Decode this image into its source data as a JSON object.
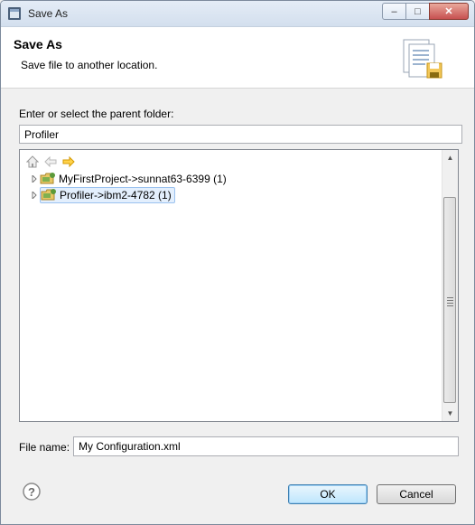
{
  "window": {
    "title": "Save As",
    "close_symbol": "✕",
    "minimize_symbol": "–",
    "maximize_symbol": "□"
  },
  "header": {
    "title": "Save As",
    "description": "Save file to another location."
  },
  "folder": {
    "label": "Enter or select the parent folder:",
    "value": "Profiler"
  },
  "tree": {
    "items": [
      {
        "label": "MyFirstProject->sunnat63-6399 (1)",
        "selected": false
      },
      {
        "label": "Profiler->ibm2-4782 (1)",
        "selected": true
      }
    ]
  },
  "file": {
    "label": "File name:",
    "value": "My Configuration.xml"
  },
  "buttons": {
    "ok": "OK",
    "cancel": "Cancel",
    "help": "?"
  },
  "colors": {
    "selection": "#e3effd",
    "ok_border": "#3c7fb1",
    "forward_arrow": "#e8a800"
  }
}
